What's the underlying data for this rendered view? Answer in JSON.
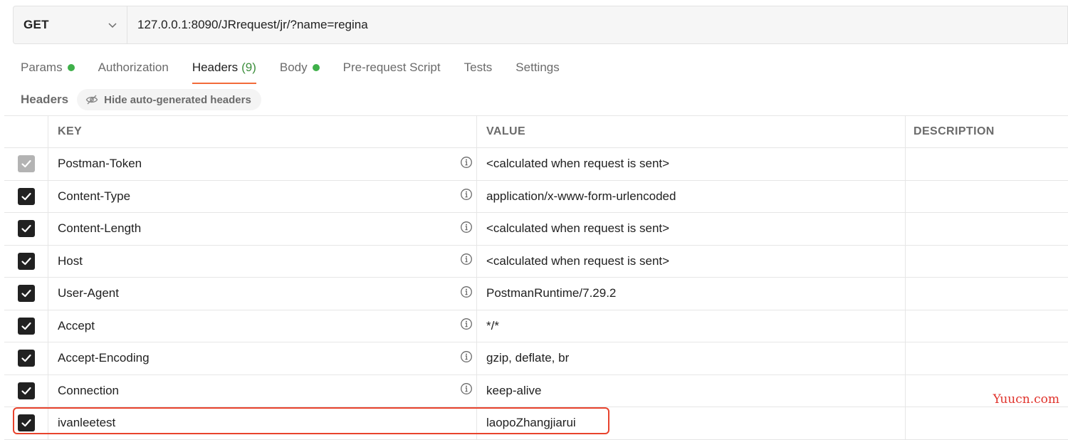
{
  "request": {
    "method": "GET",
    "url": "127.0.0.1:8090/JRrequest/jr/?name=regina"
  },
  "tabs": [
    {
      "label": "Params",
      "dot": true
    },
    {
      "label": "Authorization"
    },
    {
      "label": "Headers",
      "count": "(9)",
      "active": true
    },
    {
      "label": "Body",
      "dot": true
    },
    {
      "label": "Pre-request Script"
    },
    {
      "label": "Tests"
    },
    {
      "label": "Settings"
    }
  ],
  "subheader": {
    "title": "Headers",
    "hide_button": "Hide auto-generated headers"
  },
  "table": {
    "columns": [
      "KEY",
      "VALUE",
      "DESCRIPTION"
    ],
    "rows": [
      {
        "key": "Postman-Token",
        "value": "<calculated when request is sent>",
        "checked": true,
        "disabled": true,
        "info": true
      },
      {
        "key": "Content-Type",
        "value": "application/x-www-form-urlencoded",
        "checked": true,
        "info": true
      },
      {
        "key": "Content-Length",
        "value": "<calculated when request is sent>",
        "checked": true,
        "info": true
      },
      {
        "key": "Host",
        "value": "<calculated when request is sent>",
        "checked": true,
        "info": true
      },
      {
        "key": "User-Agent",
        "value": "PostmanRuntime/7.29.2",
        "checked": true,
        "info": true
      },
      {
        "key": "Accept",
        "value": "*/*",
        "checked": true,
        "info": true
      },
      {
        "key": "Accept-Encoding",
        "value": "gzip, deflate, br",
        "checked": true,
        "info": true
      },
      {
        "key": "Connection",
        "value": "keep-alive",
        "checked": true,
        "info": true
      },
      {
        "key": "ivanleetest",
        "value": "laopoZhangjiarui",
        "checked": true,
        "info": false
      }
    ]
  },
  "colors": {
    "accent": "#f26b3a",
    "dot": "#3fb04a",
    "highlight": "#e8432d"
  },
  "watermark": "Yuucn.com"
}
